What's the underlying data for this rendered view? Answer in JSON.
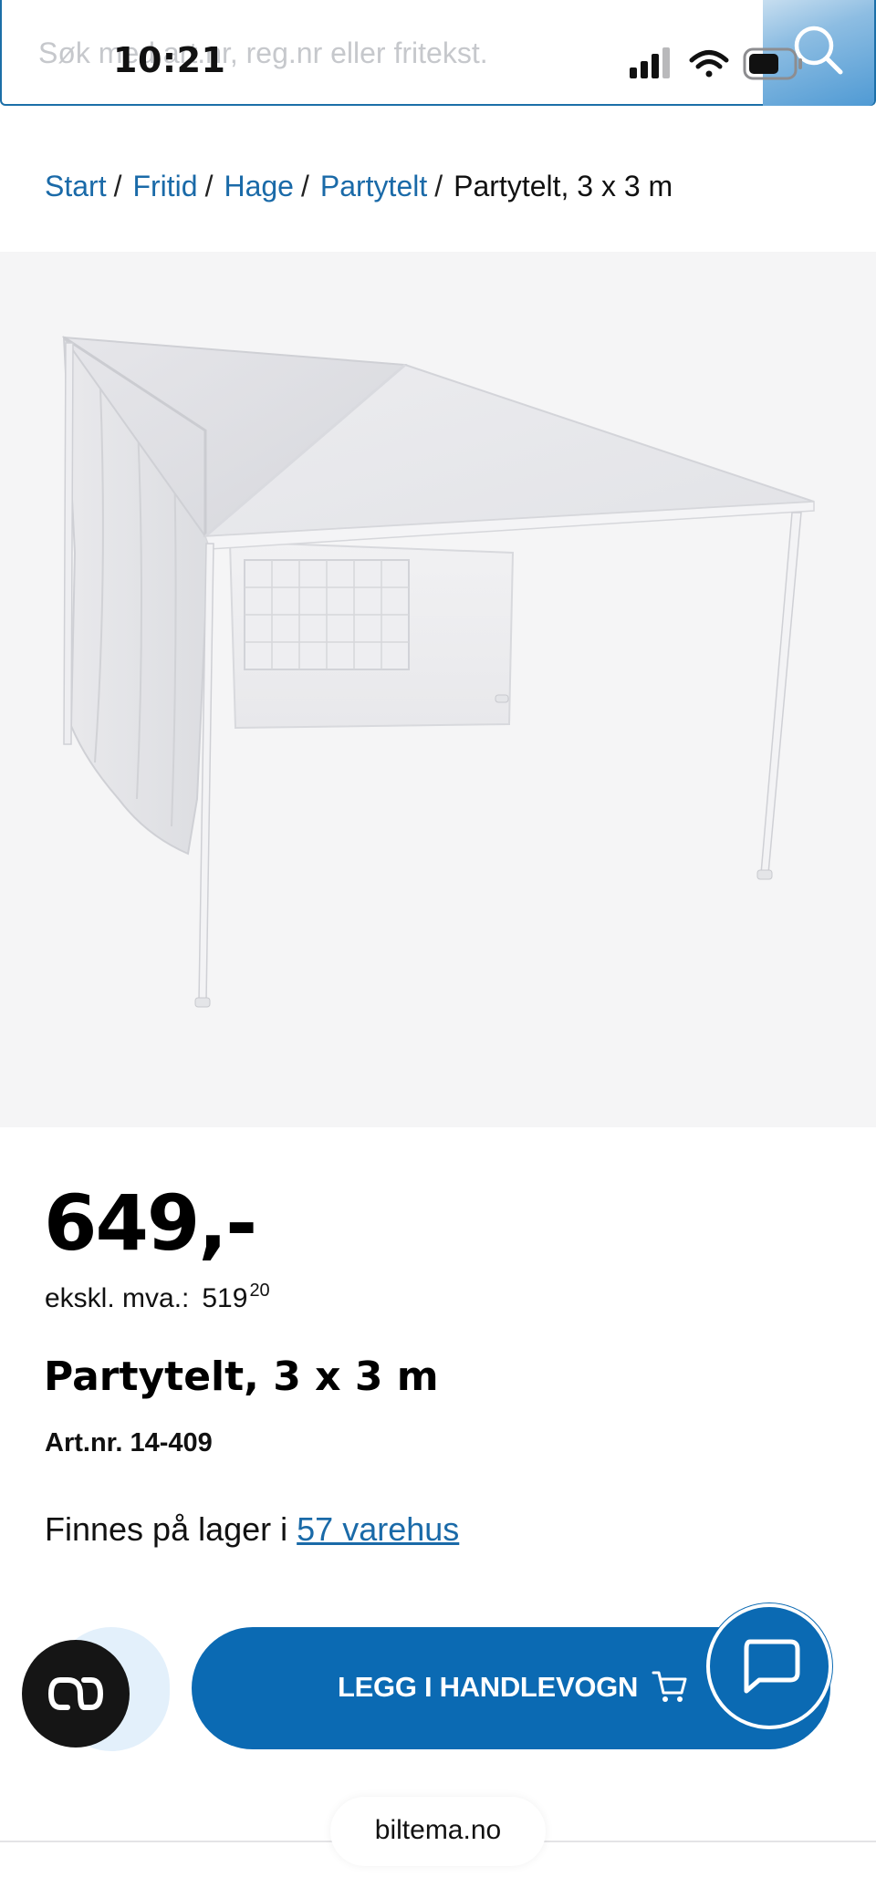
{
  "search": {
    "placeholder": "Søk med art.nr, reg.nr eller fritekst."
  },
  "status_bar": {
    "time": "10:21"
  },
  "breadcrumb": {
    "items": [
      "Start",
      "Fritid",
      "Hage",
      "Partytelt"
    ],
    "separator": "/",
    "current": "Partytelt, 3 x 3 m"
  },
  "product": {
    "price": "649,-",
    "ex_vat_label": "ekskl. mva.:",
    "ex_vat_value": "519",
    "ex_vat_cents": "20",
    "title": "Partytelt, 3 x 3 m",
    "art_nr": "Art.nr. 14-409",
    "stock_prefix": "Finnes på lager i ",
    "stock_link": "57 varehus"
  },
  "actions": {
    "add_to_cart": "LEGG I HANDLEVOGN"
  },
  "browser": {
    "url": "biltema.no"
  },
  "icons": {
    "search": "search-icon",
    "cookie": "cookie-consent-icon",
    "cart": "cart-icon",
    "chat": "chat-icon"
  },
  "colors": {
    "brand": "#0b6ab3",
    "link": "#1a6aa8",
    "text": "#111111"
  }
}
